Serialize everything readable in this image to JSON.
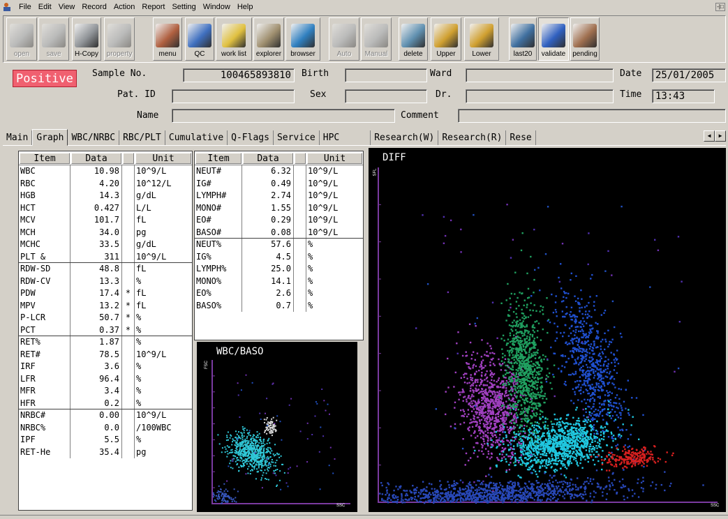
{
  "menubar": {
    "items": [
      "File",
      "Edit",
      "View",
      "Record",
      "Action",
      "Report",
      "Setting",
      "Window",
      "Help"
    ],
    "window_button": "-|□"
  },
  "toolbar": {
    "buttons": [
      {
        "label": "open",
        "icon": "open-icon",
        "enabled": false,
        "color": "#9aa0a8"
      },
      {
        "label": "save",
        "icon": "save-icon",
        "enabled": false,
        "color": "#9aa0a8"
      },
      {
        "label": "H-Copy",
        "icon": "printer-icon",
        "enabled": true,
        "color": "#909498"
      },
      {
        "label": "property",
        "icon": "property-icon",
        "enabled": false,
        "color": "#9aa0a8"
      },
      {
        "label": "menu",
        "icon": "menu-icon",
        "enabled": true,
        "color": "#b06040"
      },
      {
        "label": "QC",
        "icon": "qc-icon",
        "enabled": true,
        "color": "#4070c0"
      },
      {
        "label": "work list",
        "icon": "worklist-icon",
        "enabled": true,
        "color": "#e0c040"
      },
      {
        "label": "explorer",
        "icon": "explorer-icon",
        "enabled": true,
        "color": "#a09070"
      },
      {
        "label": "browser",
        "icon": "browser-icon",
        "enabled": true,
        "color": "#3080c0"
      },
      {
        "label": "Auto",
        "icon": "auto-icon",
        "enabled": false,
        "color": "#9aa0a8"
      },
      {
        "label": "Manual",
        "icon": "manual-icon",
        "enabled": false,
        "color": "#9aa0a8"
      },
      {
        "label": "delete",
        "icon": "trash-icon",
        "enabled": true,
        "color": "#6090b0"
      },
      {
        "label": "Upper",
        "icon": "upper-icon",
        "enabled": true,
        "color": "#d0a030"
      },
      {
        "label": "Lower",
        "icon": "lower-icon",
        "enabled": true,
        "color": "#d0a030"
      },
      {
        "label": "last20",
        "icon": "last20-icon",
        "enabled": true,
        "color": "#4070a0"
      },
      {
        "label": "validate",
        "icon": "validate-icon",
        "enabled": true,
        "active": true,
        "color": "#3060c0"
      },
      {
        "label": "pending",
        "icon": "pending-icon",
        "enabled": true,
        "color": "#a07050"
      }
    ]
  },
  "header": {
    "status_badge": "Positive",
    "sample_no_label": "Sample No.",
    "sample_no": "100465893810",
    "birth_label": "Birth",
    "birth": "",
    "ward_label": "Ward",
    "ward": "",
    "date_label": "Date",
    "date": "25/01/2005",
    "pat_id_label": "Pat. ID",
    "pat_id": "",
    "sex_label": "Sex",
    "sex": "",
    "dr_label": "Dr.",
    "dr": "",
    "time_label": "Time",
    "time": "13:43",
    "name_label": "Name",
    "name": "",
    "comment_label": "Comment",
    "comment": ""
  },
  "tabs": [
    "Main",
    "Graph",
    "WBC/NRBC",
    "RBC/PLT",
    "Cumulative",
    "Q-Flags",
    "Service",
    "HPC",
    "Research(W)",
    "Research(R)",
    "Rese"
  ],
  "active_tab": "Graph",
  "table_headers": {
    "item": "Item",
    "data": "Data",
    "unit": "Unit"
  },
  "left_table": {
    "groups": [
      [
        {
          "item": "WBC",
          "data": "10.98",
          "flag": "",
          "unit": "10^9/L"
        },
        {
          "item": "RBC",
          "data": "4.20",
          "flag": "",
          "unit": "10^12/L"
        },
        {
          "item": "HGB",
          "data": "14.3",
          "flag": "",
          "unit": "g/dL"
        },
        {
          "item": "HCT",
          "data": "0.427",
          "flag": "",
          "unit": "L/L"
        },
        {
          "item": "MCV",
          "data": "101.7",
          "flag": "",
          "unit": "fL"
        },
        {
          "item": "MCH",
          "data": "34.0",
          "flag": "",
          "unit": "pg"
        },
        {
          "item": "MCHC",
          "data": "33.5",
          "flag": "",
          "unit": "g/dL"
        },
        {
          "item": "PLT  &",
          "data": "311",
          "flag": "",
          "unit": "10^9/L"
        }
      ],
      [
        {
          "item": "RDW-SD",
          "data": "48.8",
          "flag": "",
          "unit": "fL"
        },
        {
          "item": "RDW-CV",
          "data": "13.3",
          "flag": "",
          "unit": "%"
        },
        {
          "item": "PDW",
          "data": "17.4",
          "flag": "*",
          "unit": "fL"
        },
        {
          "item": "MPV",
          "data": "13.2",
          "flag": "*",
          "unit": "fL"
        },
        {
          "item": "P-LCR",
          "data": "50.7",
          "flag": "*",
          "unit": "%"
        },
        {
          "item": "PCT",
          "data": "0.37",
          "flag": "*",
          "unit": "%"
        }
      ],
      [
        {
          "item": "RET%",
          "data": "1.87",
          "flag": "",
          "unit": "%"
        },
        {
          "item": "RET#",
          "data": "78.5",
          "flag": "",
          "unit": "10^9/L"
        },
        {
          "item": "IRF",
          "data": "3.6",
          "flag": "",
          "unit": "%"
        },
        {
          "item": "LFR",
          "data": "96.4",
          "flag": "",
          "unit": "%"
        },
        {
          "item": "MFR",
          "data": "3.4",
          "flag": "",
          "unit": "%"
        },
        {
          "item": "HFR",
          "data": "0.2",
          "flag": "",
          "unit": "%"
        }
      ],
      [
        {
          "item": "NRBC#",
          "data": "0.00",
          "flag": "",
          "unit": "10^9/L"
        },
        {
          "item": "NRBC%",
          "data": "0.0",
          "flag": "",
          "unit": "/100WBC"
        },
        {
          "item": "IPF",
          "data": "5.5",
          "flag": "",
          "unit": "%"
        },
        {
          "item": "RET-He",
          "data": "35.4",
          "flag": "",
          "unit": "pg"
        }
      ]
    ]
  },
  "right_table": {
    "groups": [
      [
        {
          "item": "NEUT#",
          "data": "6.32",
          "flag": "",
          "unit": "10^9/L"
        },
        {
          "item": "IG#",
          "data": "0.49",
          "flag": "",
          "unit": "10^9/L"
        },
        {
          "item": "LYMPH#",
          "data": "2.74",
          "flag": "",
          "unit": "10^9/L"
        },
        {
          "item": "MONO#",
          "data": "1.55",
          "flag": "",
          "unit": "10^9/L"
        },
        {
          "item": "EO#",
          "data": "0.29",
          "flag": "",
          "unit": "10^9/L"
        },
        {
          "item": "BASO#",
          "data": "0.08",
          "flag": "",
          "unit": "10^9/L"
        }
      ],
      [
        {
          "item": "NEUT%",
          "data": "57.6",
          "flag": "",
          "unit": "%"
        },
        {
          "item": "IG%",
          "data": "4.5",
          "flag": "",
          "unit": "%"
        },
        {
          "item": "LYMPH%",
          "data": "25.0",
          "flag": "",
          "unit": "%"
        },
        {
          "item": "MONO%",
          "data": "14.1",
          "flag": "",
          "unit": "%"
        },
        {
          "item": "EO%",
          "data": "2.6",
          "flag": "",
          "unit": "%"
        },
        {
          "item": "BASO%",
          "data": "0.7",
          "flag": "",
          "unit": "%"
        }
      ]
    ]
  },
  "wbc_baso_plot": {
    "title": "WBC/BASO",
    "x_axis": "SSC",
    "y_axis": "FSC",
    "axis_color": "#7a3aa0",
    "clusters": [
      {
        "name": "main",
        "color": "#30c8d8",
        "cx": 0.28,
        "cy": 0.36,
        "sx": 0.09,
        "sy": 0.06,
        "n": 650,
        "rot": -0.6
      },
      {
        "name": "baso",
        "color": "#d8d8d8",
        "cx": 0.42,
        "cy": 0.54,
        "sx": 0.025,
        "sy": 0.03,
        "n": 70,
        "rot": 0
      },
      {
        "name": "ghost",
        "color": "#3858c0",
        "cx": 0.08,
        "cy": 0.05,
        "sx": 0.05,
        "sy": 0.03,
        "n": 90,
        "rot": 0
      }
    ]
  },
  "diff_plot": {
    "title": "DIFF",
    "x_axis": "SSC",
    "y_axis": "SFL",
    "axis_color": "#7a3aa0",
    "clusters": [
      {
        "name": "lymph",
        "color": "#a040c0",
        "cx": 0.335,
        "cy": 0.285,
        "sx": 0.045,
        "sy": 0.075,
        "n": 900,
        "rot": 0.15
      },
      {
        "name": "mono",
        "color": "#20a060",
        "cx": 0.43,
        "cy": 0.4,
        "sx": 0.03,
        "sy": 0.1,
        "n": 900,
        "rot": 0.05
      },
      {
        "name": "ig",
        "color": "#2050d0",
        "cx": 0.625,
        "cy": 0.4,
        "sx": 0.04,
        "sy": 0.11,
        "n": 700,
        "rot": 0.3
      },
      {
        "name": "neut",
        "color": "#20c8e0",
        "cx": 0.53,
        "cy": 0.175,
        "sx": 0.075,
        "sy": 0.035,
        "n": 1100,
        "rot": 0.2
      },
      {
        "name": "eo",
        "color": "#d82020",
        "cx": 0.75,
        "cy": 0.135,
        "sx": 0.04,
        "sy": 0.015,
        "n": 220,
        "rot": 0
      },
      {
        "name": "debris",
        "color": "#2848b8",
        "cx": 0.3,
        "cy": 0.025,
        "sx": 0.2,
        "sy": 0.02,
        "n": 1300,
        "rot": 0.05
      }
    ]
  }
}
